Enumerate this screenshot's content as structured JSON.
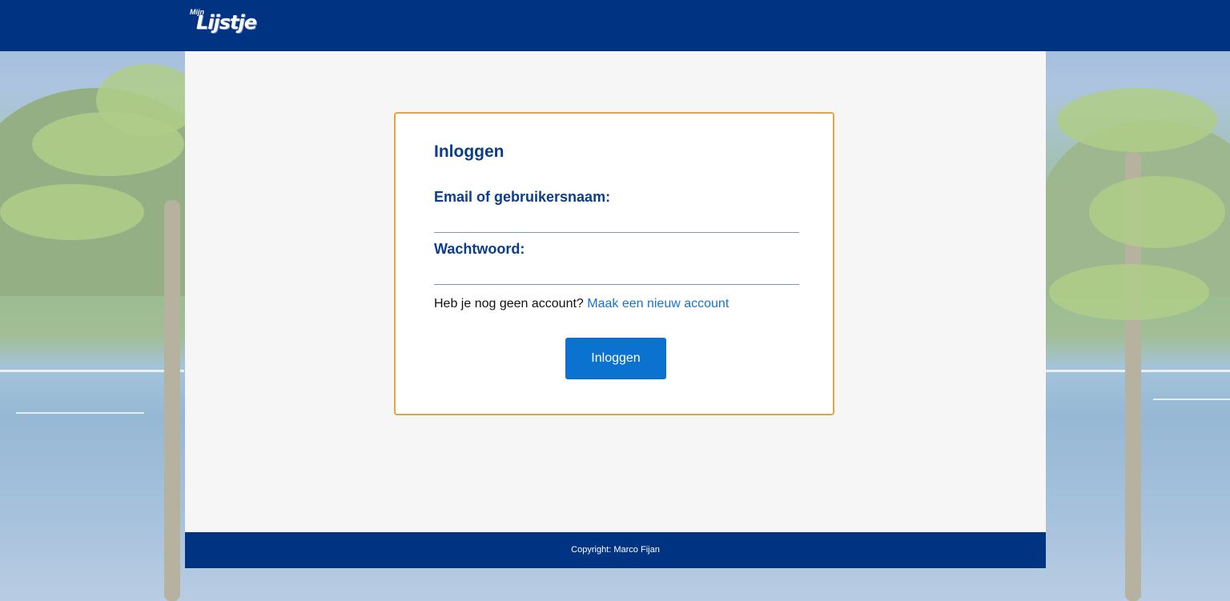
{
  "header": {
    "logo_small": "Mijn",
    "logo_main": "Lijstje"
  },
  "login": {
    "title": "Inloggen",
    "email_label": "Email of gebruikersnaam:",
    "email_value": "",
    "password_label": "Wachtwoord:",
    "password_value": "",
    "signup_prompt": "Heb je nog geen account?",
    "signup_link": "Maak een nieuw account",
    "submit_label": "Inloggen"
  },
  "footer": {
    "copyright": "Copyright: Marco Fijan"
  },
  "colors": {
    "header_bg": "#003483",
    "accent_border": "#e8a43c",
    "button_bg": "#0b72cf",
    "link": "#1a73c7",
    "heading": "#0a3d8a"
  }
}
